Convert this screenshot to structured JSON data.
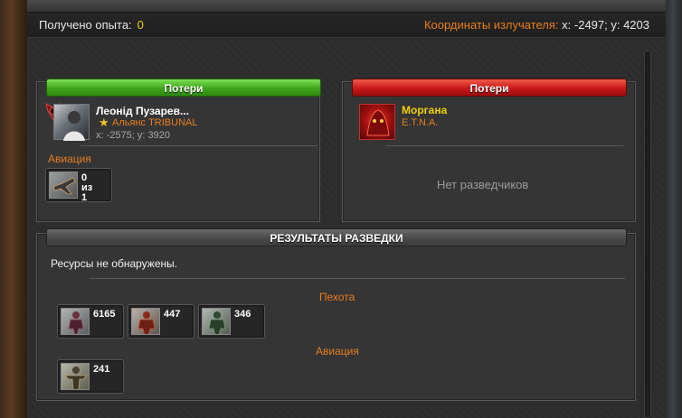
{
  "infobar": {
    "experience_label": "Получено опыта:",
    "experience_value": "0",
    "emitter_label": "Координаты излучателя:",
    "emitter_coords": "x: -2497; y: 4203"
  },
  "left_panel": {
    "header": "Потери",
    "player_name": "Леонід Пузарев...",
    "alliance": "Альянс TRIBUNAL",
    "coords": "x: -2575; y: 3920",
    "section_title": "Авиация",
    "unit": {
      "line1": "0",
      "line2": "из",
      "line3": "1",
      "icon": "aircraft-unit-icon"
    }
  },
  "right_panel": {
    "header": "Потери",
    "player_name": "Моргана",
    "alliance": "E.T.N.A.",
    "empty_text": "Нет разведчиков"
  },
  "results_panel": {
    "header": "РЕЗУЛЬТАТЫ РАЗВЕДКИ",
    "resources_text": "Ресурсы не обнаружены.",
    "infantry_title": "Пехота",
    "infantry_units": [
      {
        "count": "6165",
        "icon": "infantry-unit-icon"
      },
      {
        "count": "447",
        "icon": "infantry-unit-icon"
      },
      {
        "count": "346",
        "icon": "infantry-unit-icon"
      }
    ],
    "aviation_title": "Авиация",
    "aviation_units": [
      {
        "count": "241",
        "icon": "aircraft-unit-icon"
      }
    ]
  },
  "colors": {
    "accent_orange": "#e87d1e",
    "value_yellow": "#f0d000",
    "header_green": "#3da51a",
    "header_red": "#c81818"
  }
}
